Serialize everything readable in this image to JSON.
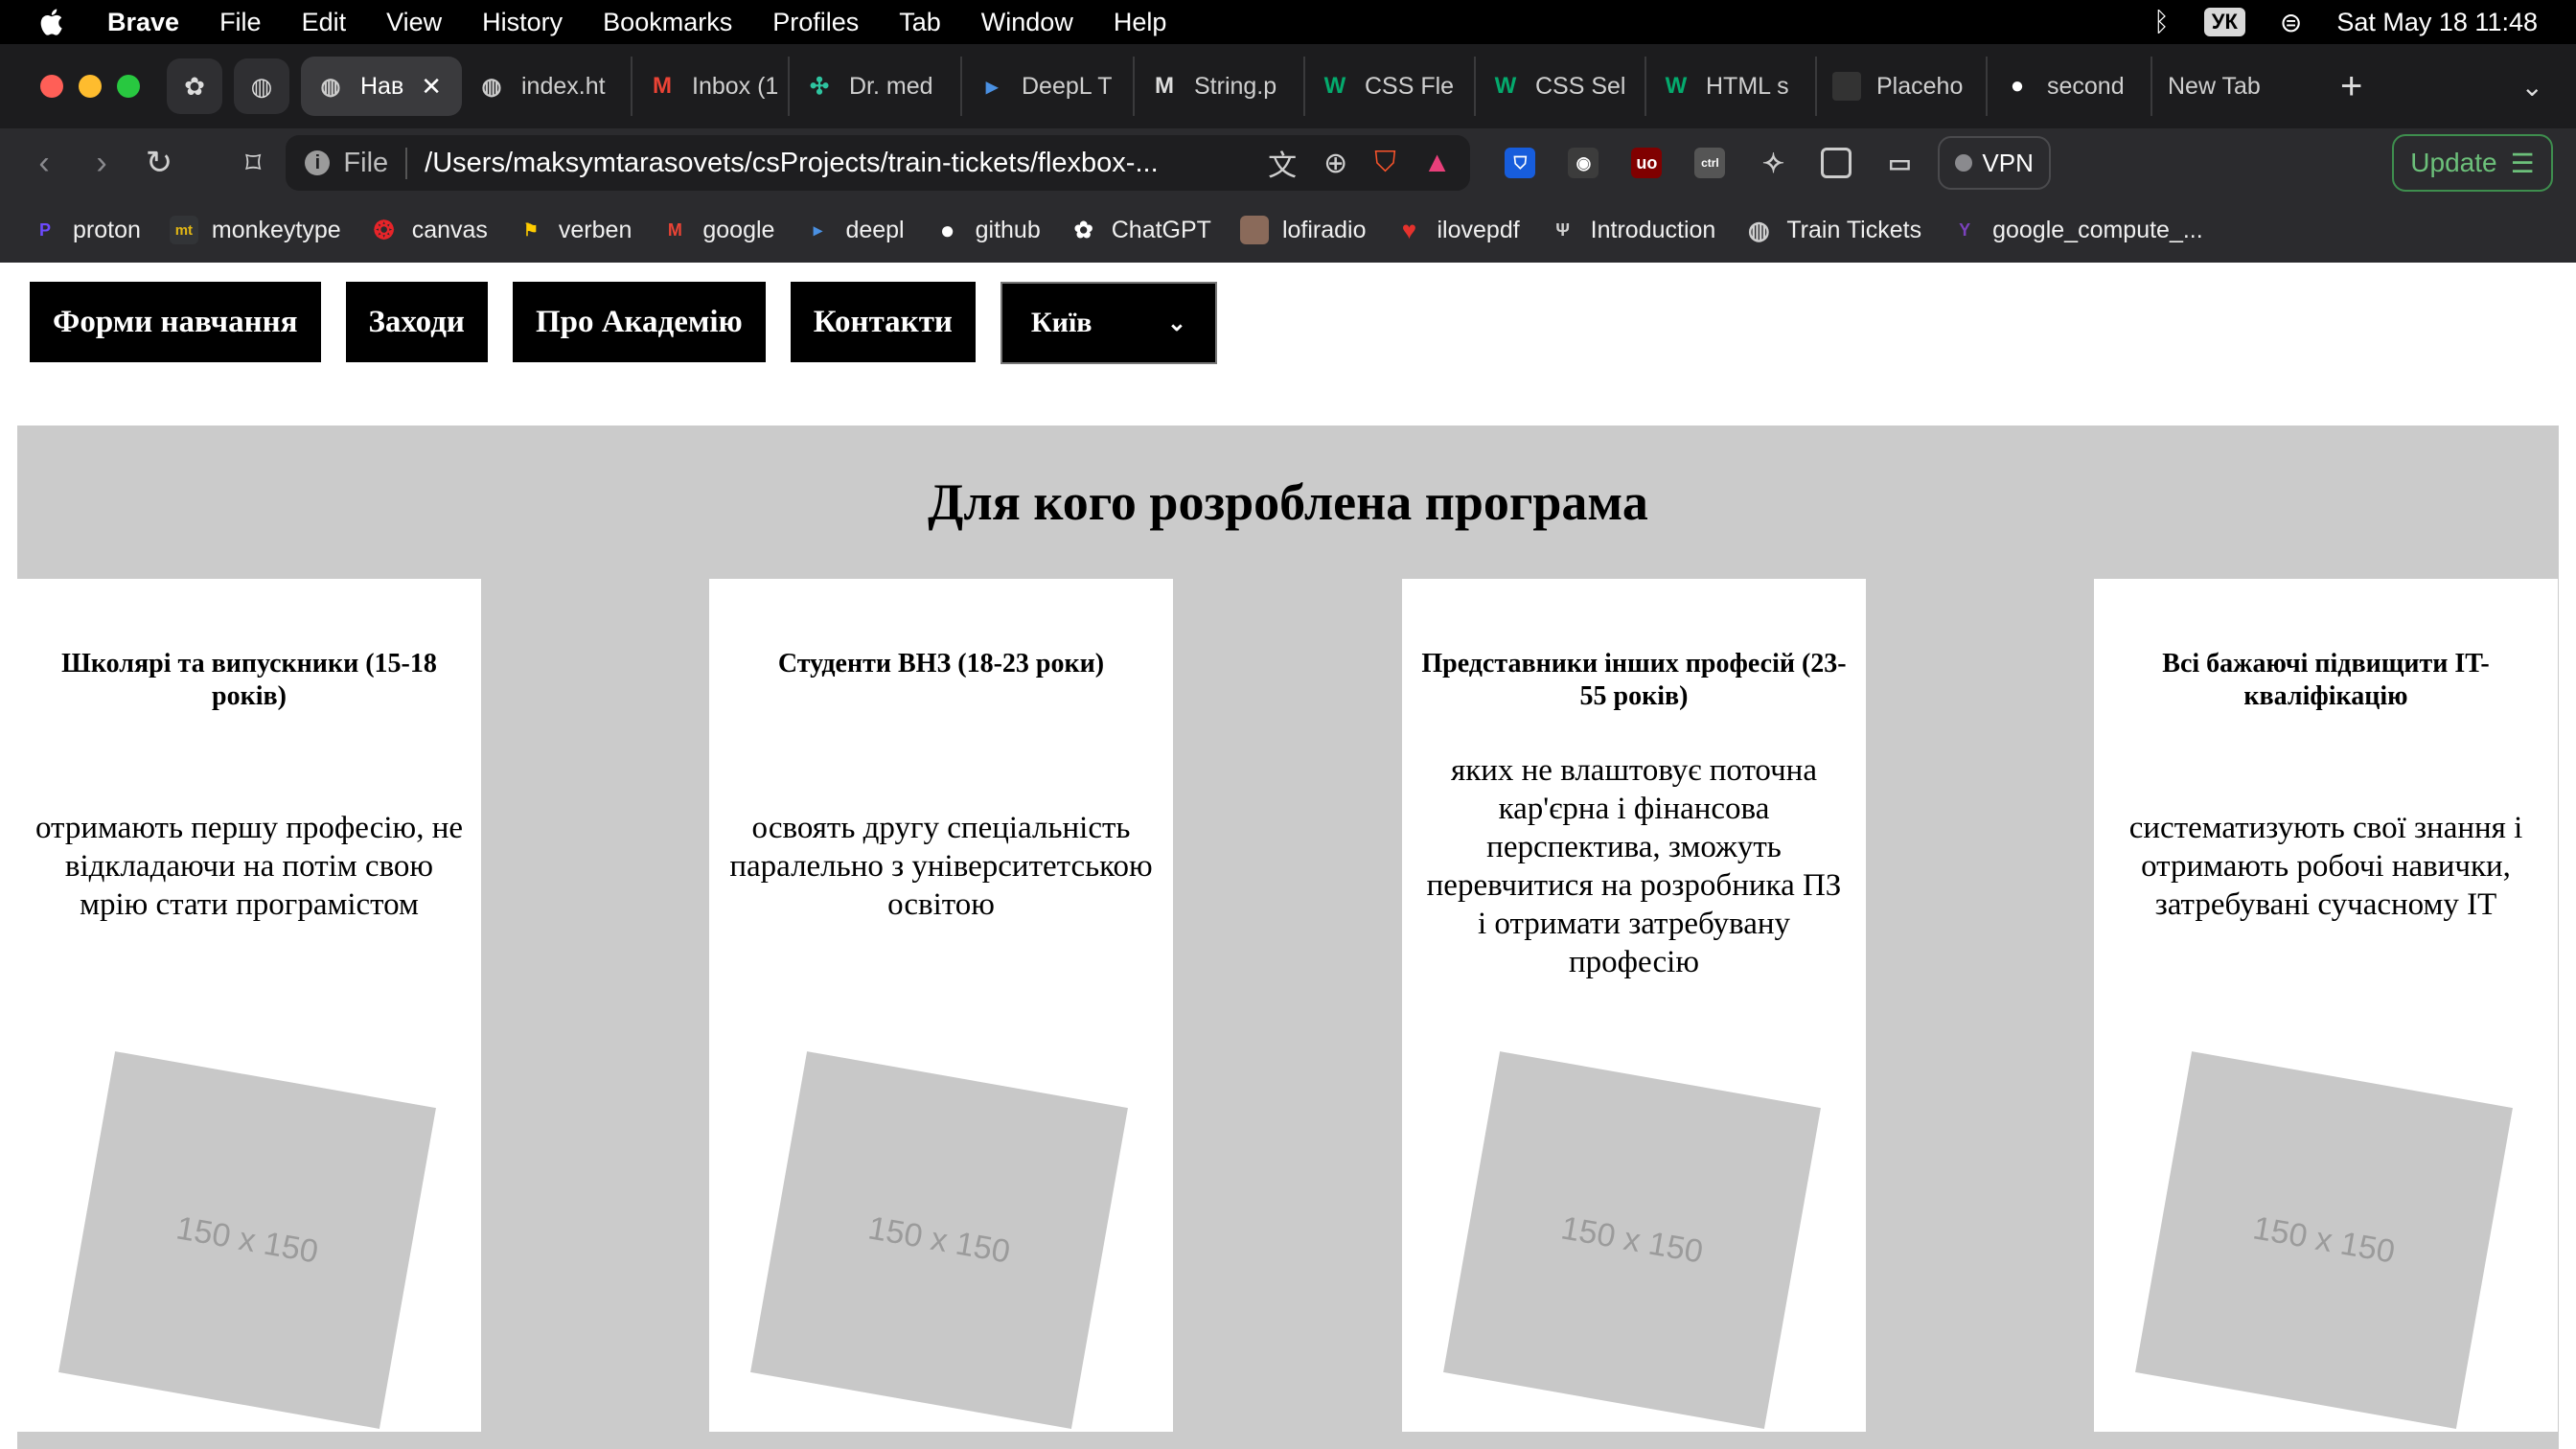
{
  "menubar": {
    "items": [
      "Brave",
      "File",
      "Edit",
      "View",
      "History",
      "Bookmarks",
      "Profiles",
      "Tab",
      "Window",
      "Help"
    ],
    "input_source": "УК",
    "datetime": "Sat May 18  11:48"
  },
  "tabs": [
    {
      "label": "Нав",
      "icon": "globe-icon",
      "active": true
    },
    {
      "label": "index.ht",
      "icon": "globe-icon"
    },
    {
      "label": "Inbox (1",
      "icon": "gmail-icon"
    },
    {
      "label": "Dr. med",
      "icon": "pinwheel-icon"
    },
    {
      "label": "DeepL T",
      "icon": "deepl-icon"
    },
    {
      "label": "String.p",
      "icon": "mdn-icon"
    },
    {
      "label": "CSS Fle",
      "icon": "w3schools-icon"
    },
    {
      "label": "CSS Sel",
      "icon": "w3schools-icon"
    },
    {
      "label": "HTML s",
      "icon": "w3schools-icon"
    },
    {
      "label": "Placeho",
      "icon": "square-icon"
    },
    {
      "label": "second",
      "icon": "github-icon"
    },
    {
      "label": "New Tab",
      "icon": ""
    }
  ],
  "toolbar": {
    "scheme": "File",
    "url": "/Users/maksymtarasovets/csProjects/train-tickets/flexbox-...",
    "vpn_label": "VPN",
    "update_label": "Update"
  },
  "bookmarks": [
    {
      "label": "proton",
      "icon": "proton-icon",
      "color": "#6d4aff"
    },
    {
      "label": "monkeytype",
      "icon": "monkeytype-icon",
      "color": "#e2b714"
    },
    {
      "label": "canvas",
      "icon": "canvas-icon",
      "color": "#e72429"
    },
    {
      "label": "verben",
      "icon": "verben-icon",
      "color": "#ffcc00"
    },
    {
      "label": "google",
      "icon": "gmail-icon",
      "color": "#ea4335"
    },
    {
      "label": "deepl",
      "icon": "deepl-icon",
      "color": "#0f2b46"
    },
    {
      "label": "github",
      "icon": "github-icon",
      "color": "#ffffff"
    },
    {
      "label": "ChatGPT",
      "icon": "chatgpt-icon",
      "color": "#ffffff"
    },
    {
      "label": "lofiradio",
      "icon": "lofiradio-icon",
      "color": "#8a6a5a"
    },
    {
      "label": "ilovepdf",
      "icon": "ilovepdf-icon",
      "color": "#e5322d"
    },
    {
      "label": "Introduction",
      "icon": "introduction-icon",
      "color": "#cfcfcf"
    },
    {
      "label": "Train Tickets",
      "icon": "globe-icon",
      "color": "#cfcfcf"
    },
    {
      "label": "google_compute_...",
      "icon": "terraform-icon",
      "color": "#7b42bc"
    }
  ],
  "page": {
    "nav": [
      "Форми навчання",
      "Заходи",
      "Про Академію",
      "Контакти"
    ],
    "city_select": "Київ",
    "section_title": "Для кого розроблена програма",
    "cards": [
      {
        "title": "Школярі та випускники (15-18 років)",
        "text": "отримають першу професію, не відкладаючи на потім свою мрію стати програмістом",
        "image_label": "150 x 150"
      },
      {
        "title": "Студенти ВНЗ (18-23 роки)",
        "text": "освоять другу спеціальність паралельно з університетською освітою",
        "image_label": "150 x 150"
      },
      {
        "title": "Представники інших професій (23-55 років)",
        "text": "яких не влаштовує поточна кар'єрна і фінансова перспектива, зможуть перевчитися на розробника ПЗ і отримати затребувану професію",
        "image_label": "150 x 150"
      },
      {
        "title": "Всі бажаючі підвищити IT-кваліфікацію",
        "text": "систематизують свої знання і отримають робочі навички, затребувані сучасному IT",
        "image_label": "150 x 150"
      }
    ]
  }
}
